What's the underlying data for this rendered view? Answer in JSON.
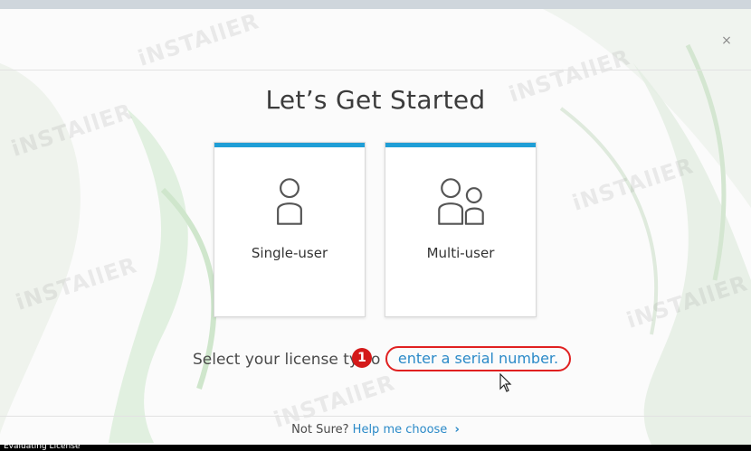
{
  "dialog": {
    "close_label": "×",
    "title": "Let’s Get Started"
  },
  "cards": [
    {
      "label": "Single-user",
      "icon": "single-user-icon"
    },
    {
      "label": "Multi-user",
      "icon": "multi-user-icon"
    }
  ],
  "prompt": {
    "text_before": "Select your license ty",
    "text_after": "o",
    "link": "enter a serial number."
  },
  "annotation": {
    "step": "1"
  },
  "footer": {
    "question": "Not Sure?",
    "help_link": "Help me choose",
    "chevron_icon": "chevron-right-icon"
  },
  "statusbar": {
    "text": "Evaluating License"
  },
  "watermark": {
    "text": "iNSTAllER"
  },
  "colors": {
    "accent": "#1f9ed6",
    "link": "#2b8ac8",
    "annotation": "#e02020"
  }
}
